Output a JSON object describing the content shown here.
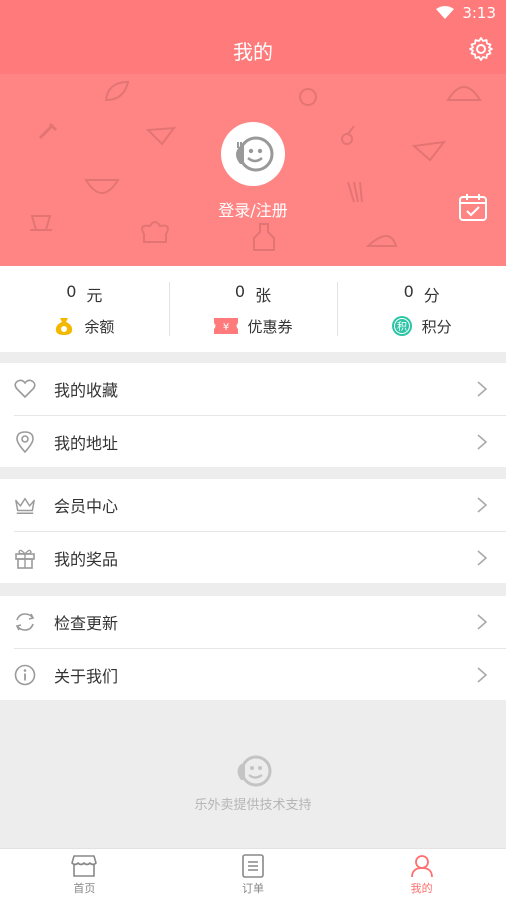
{
  "status_bar": {
    "time": "3:13"
  },
  "header": {
    "title": "我的"
  },
  "profile": {
    "login_label": "登录/注册"
  },
  "stats": [
    {
      "value": "0",
      "unit": "元",
      "label": "余额",
      "icon": "money-bag-icon",
      "color": "#f5b800"
    },
    {
      "value": "0",
      "unit": "张",
      "label": "优惠券",
      "icon": "coupon-icon",
      "color": "#ff7b7b"
    },
    {
      "value": "0",
      "unit": "分",
      "label": "积分",
      "icon": "points-icon",
      "color": "#2ec4a6",
      "icon_text": "积"
    }
  ],
  "menu": {
    "group1": [
      {
        "label": "我的收藏",
        "icon": "heart-icon"
      },
      {
        "label": "我的地址",
        "icon": "location-pin-icon"
      }
    ],
    "group2": [
      {
        "label": "会员中心",
        "icon": "crown-icon"
      },
      {
        "label": "我的奖品",
        "icon": "gift-icon"
      }
    ],
    "group3": [
      {
        "label": "检查更新",
        "icon": "refresh-icon"
      },
      {
        "label": "关于我们",
        "icon": "info-icon"
      }
    ]
  },
  "footer": {
    "support_text": "乐外卖提供技术支持"
  },
  "tabbar": [
    {
      "label": "首页",
      "icon": "store-icon",
      "active": false
    },
    {
      "label": "订单",
      "icon": "order-list-icon",
      "active": false
    },
    {
      "label": "我的",
      "icon": "user-icon",
      "active": true
    }
  ],
  "colors": {
    "accent": "#ff7b7b",
    "hero": "#ff8585",
    "active_tab": "#ff6f6f"
  }
}
